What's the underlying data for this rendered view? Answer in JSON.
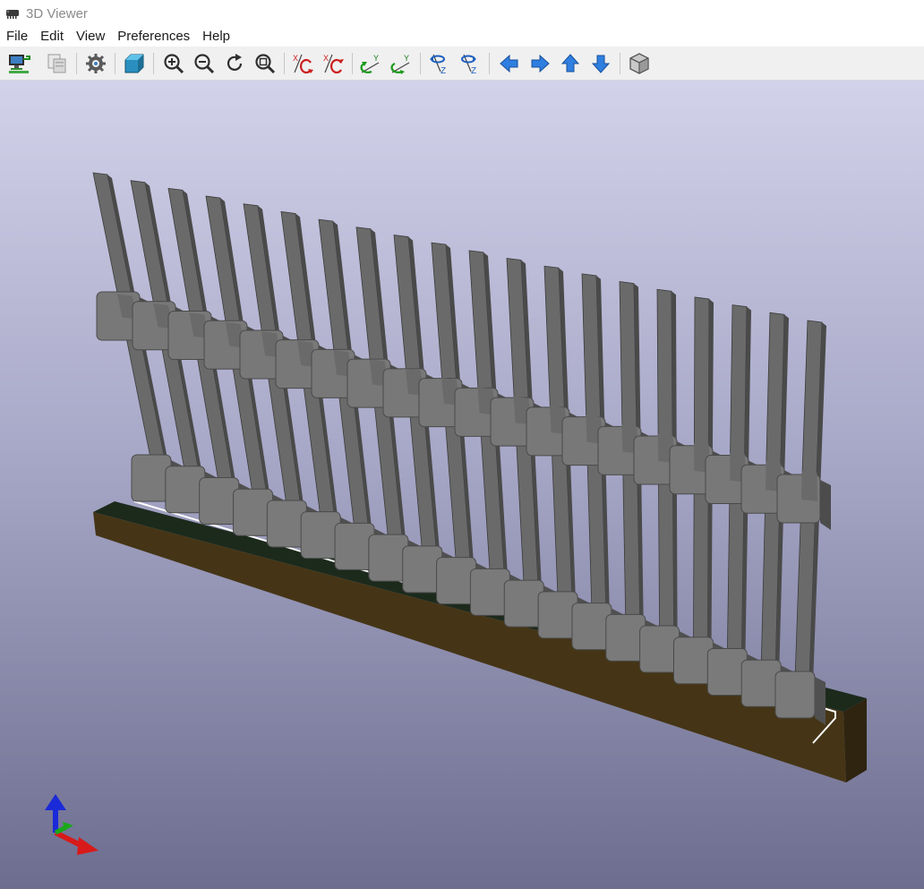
{
  "window": {
    "title": "3D Viewer",
    "icon": "chip-icon"
  },
  "menubar": {
    "items": [
      "File",
      "Edit",
      "View",
      "Preferences",
      "Help"
    ]
  },
  "toolbar": {
    "icons": [
      "export-image-icon",
      "copy-clipboard-icon",
      "settings-gear-icon",
      "raytrace-cube-icon",
      "zoom-in-icon",
      "zoom-out-icon",
      "refresh-icon",
      "zoom-fit-icon",
      "rotate-x-cw-icon",
      "rotate-x-ccw-icon",
      "rotate-y-cw-icon",
      "rotate-y-ccw-icon",
      "rotate-z-cw-icon",
      "rotate-z-ccw-icon",
      "move-left-icon",
      "move-right-icon",
      "move-up-icon",
      "move-down-icon",
      "ortho-cube-icon"
    ]
  },
  "viewport": {
    "model": "pin-header-1x20",
    "pin_count": 20,
    "axes": [
      "x-axis-red",
      "y-axis-green",
      "z-axis-blue"
    ],
    "colors": {
      "pcb": "#1e2e1e",
      "pcb_edge": "#4a3a1a",
      "pin": "#6e6e6e",
      "silkscreen": "#ffffff"
    }
  }
}
